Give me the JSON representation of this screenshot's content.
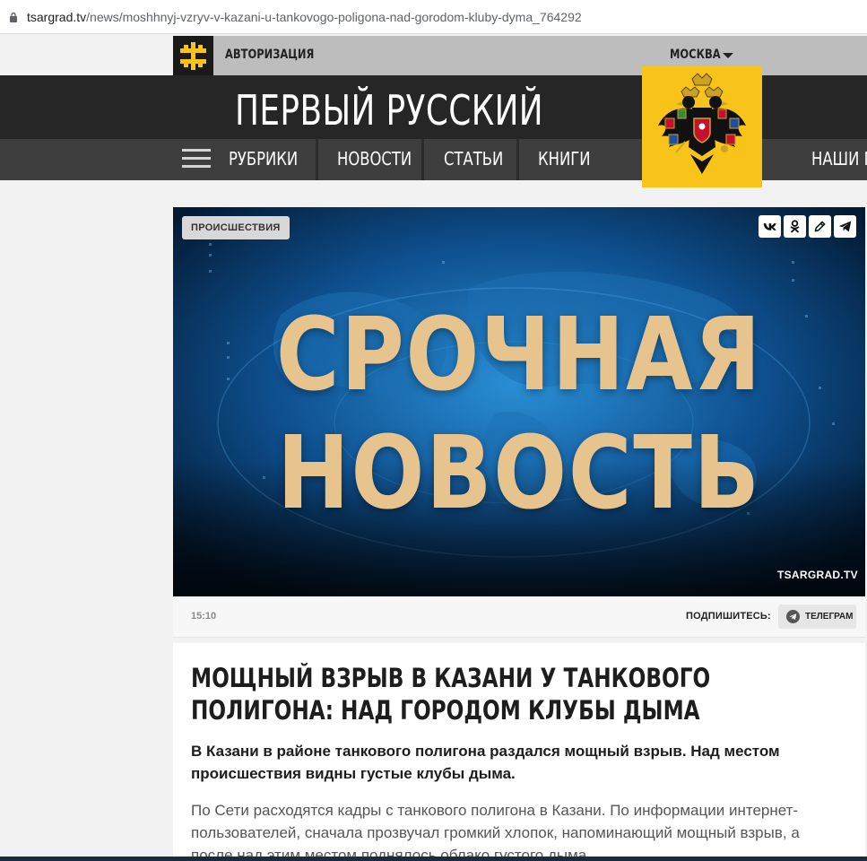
{
  "browser": {
    "url_host": "tsargrad.tv",
    "url_path": "/news/moshhnyj-vzryv-v-kazani-u-tankovogo-poligona-nad-gorodom-kluby-dyma_764292"
  },
  "header": {
    "auth_label": "АВТОРИЗАЦИЯ",
    "city_label": "МОСКВА",
    "site_title": "ПЕРВЫЙ РУССКИЙ",
    "logo_color": "#f8c419",
    "nav": {
      "rubrics": "РУБРИКИ",
      "news": "НОВОСТИ",
      "articles": "СТАТЬИ",
      "books": "КНИГИ",
      "ours": "НАШИ Г"
    }
  },
  "article": {
    "tag": "ПРОИСШЕСТВИЯ",
    "hero_line1": "СРОЧНАЯ",
    "hero_line2": "НОВОСТЬ",
    "watermark": "TSARGRAD.TV",
    "time": "15:10",
    "subscribe_label": "ПОДПИШИТЕСЬ:",
    "telegram_label": "ТЕЛЕГРАМ",
    "headline": "МОЩНЫЙ ВЗРЫВ В КАЗАНИ У ТАНКОВОГО ПОЛИГОНА: НАД ГОРОДОМ КЛУБЫ ДЫМА",
    "lead": "В Казани в районе танкового полигона раздался мощный взрыв. Над местом происшествия видны густые клубы дыма.",
    "body": "По Сети расходятся кадры с танкового полигона в Казани. По информации интернет-пользователей, сначала прозвучал громкий хлопок, напоминающий мощный взрыв, а после над этим местом поднялось облако густого дыма."
  },
  "share_icons": [
    "vk-icon",
    "odnoklassniki-icon",
    "edit-icon",
    "telegram-icon"
  ],
  "colors": {
    "brand_yellow": "#f8c419",
    "masthead": "#262626",
    "navbar": "#3e3e3e",
    "hero_text": "#e7c48d"
  }
}
